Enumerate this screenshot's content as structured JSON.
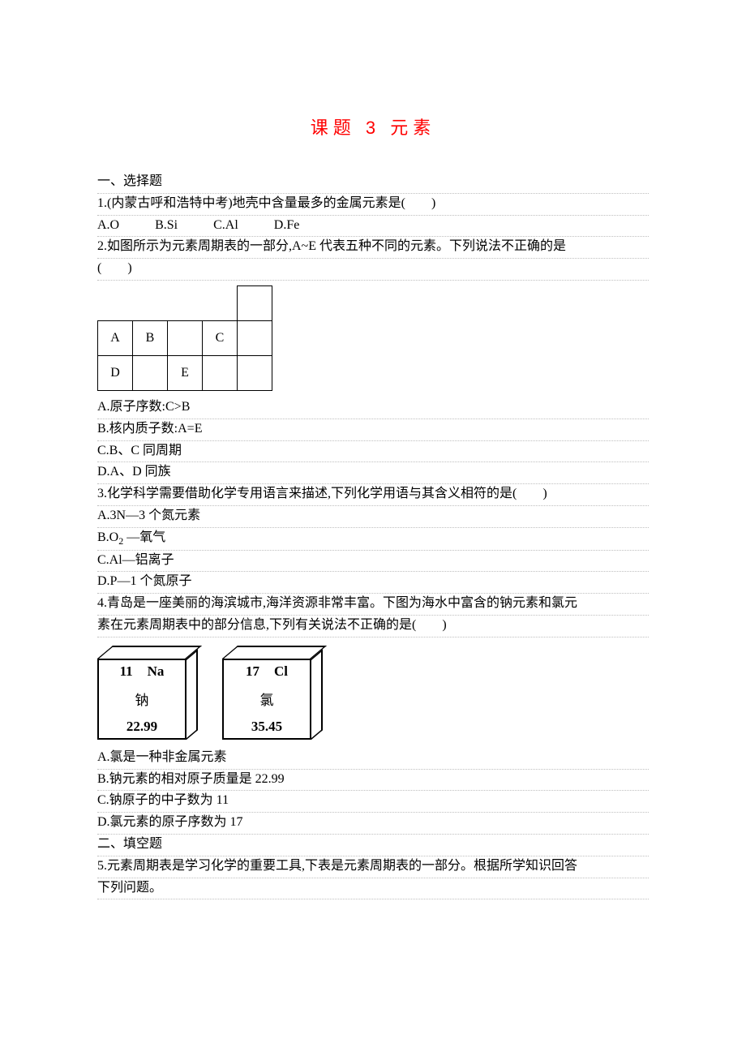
{
  "title": "课题 3 元素",
  "section1": "一、选择题",
  "q1": {
    "stem": "1.(内蒙古呼和浩特中考)地壳中含量最多的金属元素是(　　)",
    "optA": "A.O",
    "optB": "B.Si",
    "optC": "C.Al",
    "optD": "D.Fe"
  },
  "q2": {
    "stem1": "2.如图所示为元素周期表的一部分,A~E 代表五种不同的元素。下列说法不正确的是",
    "stem2": "(　　)",
    "cells": {
      "A": "A",
      "B": "B",
      "C": "C",
      "D": "D",
      "E": "E"
    },
    "optA": "A.原子序数:C>B",
    "optB": "B.核内质子数:A=E",
    "optC": "C.B、C 同周期",
    "optD": "D.A、D 同族"
  },
  "q3": {
    "stem": "3.化学科学需要借助化学专用语言来描述,下列化学用语与其含义相符的是(　　)",
    "optA": "A.3N—3 个氮元素",
    "optB_pre": "B.O",
    "optB_sub": "2",
    "optB_post": " —氧气",
    "optC": "C.Al—铝离子",
    "optD": "D.P—1 个氮原子"
  },
  "q4": {
    "stem1": "4.青岛是一座美丽的海滨城市,海洋资源非常丰富。下图为海水中富含的钠元素和氯元",
    "stem2": "素在元素周期表中的部分信息,下列有关说法不正确的是(　　)",
    "na": {
      "num": "11",
      "sym": "Na",
      "name": "钠",
      "mass": "22.99"
    },
    "cl": {
      "num": "17",
      "sym": "Cl",
      "name": "氯",
      "mass": "35.45"
    },
    "optA": "A.氯是一种非金属元素",
    "optB": "B.钠元素的相对原子质量是 22.99",
    "optC": "C.钠原子的中子数为 11",
    "optD": "D.氯元素的原子序数为 17"
  },
  "section2": "二、填空题",
  "q5": {
    "stem1": "5.元素周期表是学习化学的重要工具,下表是元素周期表的一部分。根据所学知识回答",
    "stem2": "下列问题。"
  }
}
